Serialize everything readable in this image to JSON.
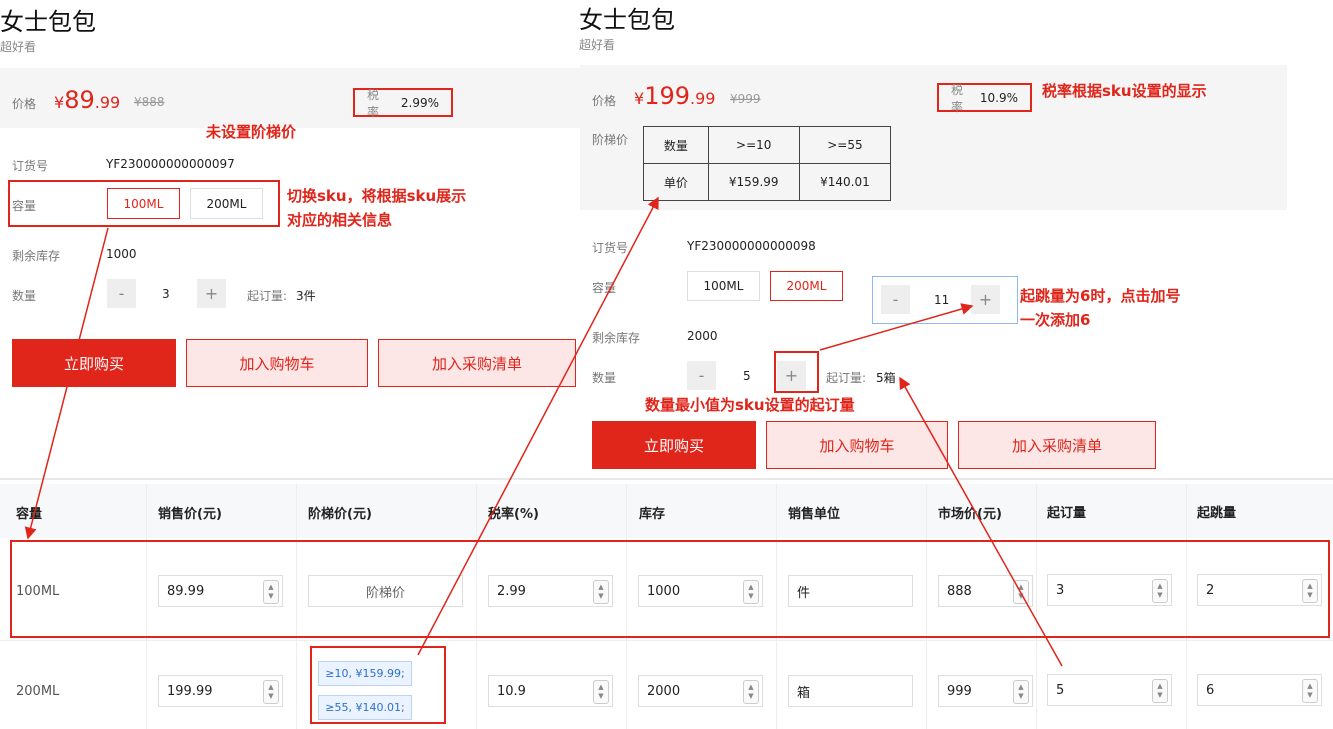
{
  "left": {
    "title": "女士包包",
    "subtitle": "超好看",
    "price_label": "价格",
    "currency": "¥",
    "price_int": "89",
    "price_dec": ".99",
    "old_price": "¥888",
    "tax_label": "税率",
    "tax_value": "2.99%",
    "order_no_label": "订货号",
    "order_no": "YF230000000000097",
    "capacity_label": "容量",
    "options": [
      "100ML",
      "200ML"
    ],
    "stock_label": "剩余库存",
    "stock": "1000",
    "qty_label": "数量",
    "qty_minus": "-",
    "qty_value": "3",
    "qty_plus": "+",
    "moq_label": "起订量:",
    "moq_value": "3件",
    "buy_now": "立即购买",
    "add_cart": "加入购物车",
    "add_purchase": "加入采购清单"
  },
  "right": {
    "title": "女士包包",
    "subtitle": "超好看",
    "price_label": "价格",
    "currency": "¥",
    "price_int": "199",
    "price_dec": ".99",
    "old_price": "¥999",
    "tax_label": "税率",
    "tax_value": "10.9%",
    "tier_label": "阶梯价",
    "tier_table": {
      "row1": [
        "数量",
        ">=10",
        ">=55"
      ],
      "row2": [
        "单价",
        "¥159.99",
        "¥140.01"
      ]
    },
    "order_no_label": "订货号",
    "order_no": "YF230000000000098",
    "capacity_label": "容量",
    "options": [
      "100ML",
      "200ML"
    ],
    "stock_label": "剩余库存",
    "stock": "2000",
    "qty_label": "数量",
    "qty_minus": "-",
    "qty_value": "5",
    "qty_plus": "+",
    "moq_label": "起订量:",
    "moq_value": "5箱",
    "popup_minus": "-",
    "popup_value": "11",
    "popup_plus": "+",
    "buy_now": "立即购买",
    "add_cart": "加入购物车",
    "add_purchase": "加入采购清单"
  },
  "annotations": {
    "no_tier": "未设置阶梯价",
    "switch_sku_1": "切换sku，将根据sku展示",
    "switch_sku_2": "对应的相关信息",
    "tax_by_sku": "税率根据sku设置的显示",
    "step_1": "起跳量为6时，点击加号",
    "step_2": "一次添加6",
    "min_qty": "数量最小值为sku设置的起订量"
  },
  "table": {
    "headers": [
      "容量",
      "销售价(元)",
      "阶梯价(元)",
      "税率(%)",
      "库存",
      "销售单位",
      "市场价(元)",
      "起订量",
      "起跳量"
    ],
    "row1": {
      "capacity": "100ML",
      "price": "89.99",
      "tier_button": "阶梯价",
      "tax": "2.99",
      "stock": "1000",
      "unit": "件",
      "market": "888",
      "moq": "3",
      "step": "2"
    },
    "row2": {
      "capacity": "200ML",
      "price": "199.99",
      "tier_tags": [
        "≥10, ¥159.99;",
        "≥55, ¥140.01;"
      ],
      "tax": "10.9",
      "stock": "2000",
      "unit": "箱",
      "market": "999",
      "moq": "5",
      "step": "6"
    }
  },
  "colors": {
    "accent": "#e0251b",
    "pink_bg": "#fde6e6",
    "tag_blue": "#2f6fd1"
  }
}
